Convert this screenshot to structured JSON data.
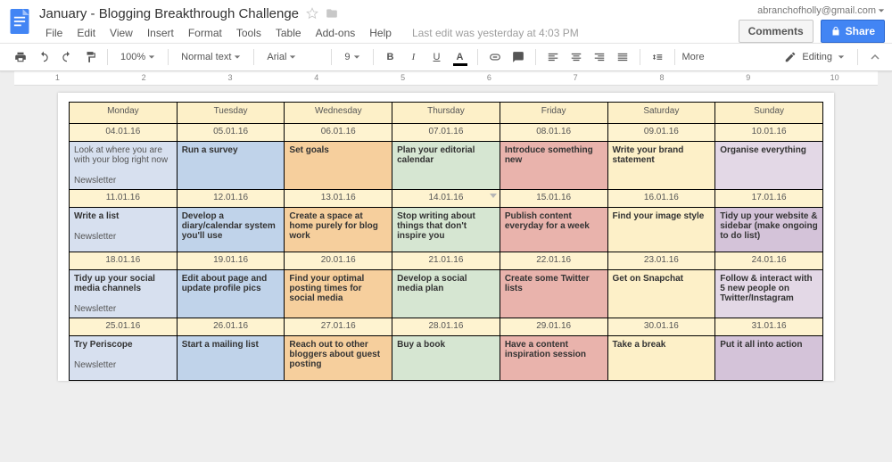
{
  "header": {
    "doc_title": "January - Blogging Breakthrough Challenge",
    "account_email": "abranchofholly@gmail.com",
    "last_edit": "Last edit was yesterday at 4:03 PM",
    "comments_btn": "Comments",
    "share_btn": "Share"
  },
  "menu": [
    "File",
    "Edit",
    "View",
    "Insert",
    "Format",
    "Tools",
    "Table",
    "Add-ons",
    "Help"
  ],
  "toolbar": {
    "zoom": "100%",
    "style": "Normal text",
    "font": "Arial",
    "size": "9",
    "more": "More",
    "editing": "Editing"
  },
  "ruler_numbers": [
    "1",
    "2",
    "3",
    "4",
    "5",
    "6",
    "7",
    "8",
    "9",
    "10"
  ],
  "calendar": {
    "headers": [
      "Monday",
      "Tuesday",
      "Wednesday",
      "Thursday",
      "Friday",
      "Saturday",
      "Sunday"
    ],
    "weeks": [
      {
        "dates": [
          "04.01.16",
          "05.01.16",
          "06.01.16",
          "07.01.16",
          "08.01.16",
          "09.01.16",
          "10.01.16"
        ],
        "tasks": [
          {
            "text": "Look at where you are with your blog right now",
            "sub": "Newsletter",
            "cls": "c-blue1",
            "bold": false
          },
          {
            "text": "Run a survey",
            "cls": "c-blue2"
          },
          {
            "text": "Set goals",
            "cls": "c-orange"
          },
          {
            "text": "Plan your editorial calendar",
            "cls": "c-green",
            "bold": true
          },
          {
            "text": "Introduce something new",
            "cls": "c-red",
            "bold": true
          },
          {
            "text": "Write your brand statement",
            "cls": "c-yellow",
            "bold": true
          },
          {
            "text": "Organise everything",
            "cls": "c-purple1",
            "bold": true
          }
        ]
      },
      {
        "dates": [
          "11.01.16",
          "12.01.16",
          "13.01.16",
          "14.01.16",
          "15.01.16",
          "16.01.16",
          "17.01.16"
        ],
        "date_dd_index": 3,
        "tasks": [
          {
            "text": "Write a list",
            "sub": "Newsletter",
            "cls": "c-blue1",
            "bold": true
          },
          {
            "text": "Develop a diary/calendar system you'll use",
            "cls": "c-blue2",
            "bold": true
          },
          {
            "text": "Create a space at home purely for blog work",
            "cls": "c-orange",
            "bold": true
          },
          {
            "text": "Stop writing about things that don't inspire you",
            "cls": "c-green",
            "bold": true
          },
          {
            "text": "Publish content everyday for a week",
            "cls": "c-red",
            "bold": true
          },
          {
            "text": "Find your image style",
            "cls": "c-yellow",
            "bold": true
          },
          {
            "text": "Tidy up your website & sidebar (make ongoing to do list)",
            "cls": "c-purple2",
            "bold": true
          }
        ]
      },
      {
        "dates": [
          "18.01.16",
          "19.01.16",
          "20.01.16",
          "21.01.16",
          "22.01.16",
          "23.01.16",
          "24.01.16"
        ],
        "tasks": [
          {
            "text": "Tidy up your social media channels",
            "sub": "Newsletter",
            "cls": "c-blue1",
            "bold": true
          },
          {
            "text": "Edit about page and update profile pics",
            "cls": "c-blue2",
            "bold": true
          },
          {
            "text": "Find your optimal posting times for social media",
            "cls": "c-orange",
            "bold": true
          },
          {
            "text": "Develop a social media plan",
            "cls": "c-green",
            "bold": true
          },
          {
            "text": "Create some Twitter lists",
            "cls": "c-red",
            "bold": true
          },
          {
            "text": "Get on Snapchat",
            "cls": "c-yellow",
            "bold": true
          },
          {
            "text": "Follow & interact with 5 new people on Twitter/Instagram",
            "cls": "c-purple1",
            "bold": true
          }
        ]
      },
      {
        "dates": [
          "25.01.16",
          "26.01.16",
          "27.01.16",
          "28.01.16",
          "29.01.16",
          "30.01.16",
          "31.01.16"
        ],
        "tasks": [
          {
            "text": "Try Periscope",
            "sub": "Newsletter",
            "cls": "c-blue1",
            "bold": true
          },
          {
            "text": "Start a mailing list",
            "cls": "c-blue2",
            "bold": true
          },
          {
            "text": "Reach out to other bloggers about guest posting",
            "cls": "c-orange",
            "bold": true
          },
          {
            "text": "Buy a book",
            "cls": "c-green",
            "bold": true
          },
          {
            "text": "Have a content inspiration session",
            "cls": "c-red",
            "bold": true
          },
          {
            "text": "Take a break",
            "cls": "c-yellow",
            "bold": true
          },
          {
            "text": "Put it all into action",
            "cls": "c-purple2",
            "bold": true
          }
        ]
      }
    ]
  }
}
